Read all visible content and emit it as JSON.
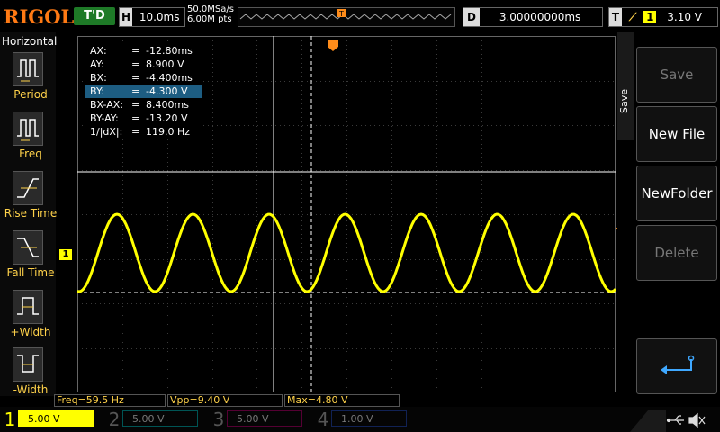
{
  "header": {
    "logo": "RIGOL",
    "run_state": "T'D",
    "h_label": "H",
    "timebase": "10.0ms",
    "sample_rate": "50.0MSa/s",
    "memory_depth": "6.00M pts",
    "d_label": "D",
    "delay": "3.00000000ms",
    "trig_label": "T",
    "trig_channel": "1",
    "trig_level": "3.10 V",
    "trig_marker": "T"
  },
  "left_menu": {
    "title": "Horizontal",
    "items": [
      {
        "label": "Period",
        "icon": "period-icon"
      },
      {
        "label": "Freq",
        "icon": "freq-icon"
      },
      {
        "label": "Rise Time",
        "icon": "rise-time-icon"
      },
      {
        "label": "Fall Time",
        "icon": "fall-time-icon"
      },
      {
        "label": "+Width",
        "icon": "positive-width-icon"
      },
      {
        "label": "-Width",
        "icon": "negative-width-icon"
      }
    ]
  },
  "cursor_table": [
    {
      "key": "AX:",
      "eq": "=",
      "value": "-12.80ms"
    },
    {
      "key": "AY:",
      "eq": "=",
      "value": "8.900 V"
    },
    {
      "key": "BX:",
      "eq": "=",
      "value": "-4.400ms"
    },
    {
      "key": "BY:",
      "eq": "=",
      "value": "-4.300 V"
    },
    {
      "key": "BX-AX:",
      "eq": "=",
      "value": "8.400ms"
    },
    {
      "key": "BY-AY:",
      "eq": "=",
      "value": "-13.20 V"
    },
    {
      "key": "1/|dX|:",
      "eq": "=",
      "value": "119.0 Hz"
    }
  ],
  "channel1_marker": "1",
  "right_menu": {
    "tab": "Save",
    "buttons": [
      {
        "label": "Save",
        "enabled": false
      },
      {
        "label": "New File",
        "enabled": true
      },
      {
        "label": "NewFolder",
        "enabled": true
      },
      {
        "label": "Delete",
        "enabled": false
      },
      {
        "label": "",
        "icon": "return-icon",
        "enabled": true
      }
    ]
  },
  "measurements": [
    {
      "text": "Freq=59.5 Hz"
    },
    {
      "text": "Vpp=9.40 V"
    },
    {
      "text": "Max=4.80 V"
    }
  ],
  "channels": [
    {
      "num": "1",
      "scale": "5.00 V",
      "color": "#ffff00",
      "active": true
    },
    {
      "num": "2",
      "scale": "5.00 V",
      "color": "#00e5e5",
      "active": false
    },
    {
      "num": "3",
      "scale": "5.00 V",
      "color": "#ff33cc",
      "active": false
    },
    {
      "num": "4",
      "scale": "1.00 V",
      "color": "#3a78ff",
      "active": false
    }
  ],
  "colors": {
    "ch1": "#ffff00",
    "accent": "#ff8c1a",
    "run_green": "#1e7a27",
    "selected_row": "#1d5d82"
  }
}
